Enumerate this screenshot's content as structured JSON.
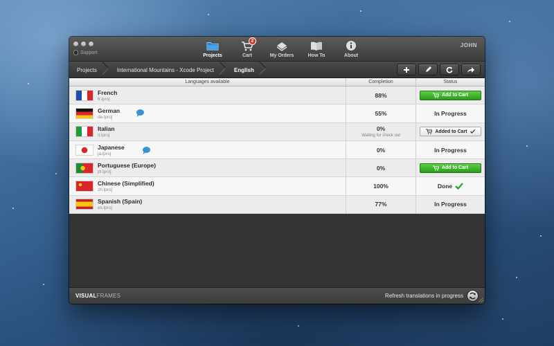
{
  "window": {
    "support_label": "Support",
    "user_name": "JOHN"
  },
  "tabs": [
    {
      "label": "Projects",
      "icon": "folder-icon"
    },
    {
      "label": "Cart",
      "icon": "cart-icon",
      "badge": "2"
    },
    {
      "label": "My Orders",
      "icon": "orders-icon"
    },
    {
      "label": "How To",
      "icon": "book-icon"
    },
    {
      "label": "About",
      "icon": "info-icon"
    }
  ],
  "breadcrumb": [
    "Projects",
    "International Mountains - Xcode Project",
    "English"
  ],
  "toolbar_actions": [
    "add-icon",
    "edit-icon",
    "refresh-icon",
    "share-icon"
  ],
  "table": {
    "headers": {
      "languages": "Languages available",
      "completion": "Completion",
      "status": "Status"
    },
    "rows": [
      {
        "name": "French",
        "file": "fr.lproj",
        "completion": "88%",
        "note": "",
        "status": "Add to Cart",
        "status_type": "add",
        "comment": false
      },
      {
        "name": "German",
        "file": "de.lproj",
        "completion": "55%",
        "note": "",
        "status": "In Progress",
        "status_type": "text",
        "comment": true
      },
      {
        "name": "Italian",
        "file": "it.lproj",
        "completion": "0%",
        "note": "Waiting for check out",
        "status": "Added to Cart",
        "status_type": "added",
        "comment": false
      },
      {
        "name": "Japanese",
        "file": "ja.lproj",
        "completion": "0%",
        "note": "",
        "status": "In Progress",
        "status_type": "text",
        "comment": true
      },
      {
        "name": "Portuguese (Europe)",
        "file": "pt.lproj",
        "completion": "0%",
        "note": "",
        "status": "Add to Cart",
        "status_type": "add",
        "comment": false
      },
      {
        "name": "Chinese (Simplified)",
        "file": "zh.lproj",
        "completion": "100%",
        "note": "",
        "status": "Done",
        "status_type": "done",
        "comment": false
      },
      {
        "name": "Spanish (Spain)",
        "file": "es.lproj",
        "completion": "77%",
        "note": "",
        "status": "In Progress",
        "status_type": "text",
        "comment": false
      }
    ]
  },
  "footer": {
    "brand_bold": "VISUAL",
    "brand_light": "FRAMES",
    "refresh_label": "Refresh translations in progress"
  },
  "colors": {
    "add_to_cart_green": "#3fb52c",
    "comment_blue": "#3a92d6",
    "done_check": "#2fa827",
    "badge_red": "#d8301f"
  }
}
